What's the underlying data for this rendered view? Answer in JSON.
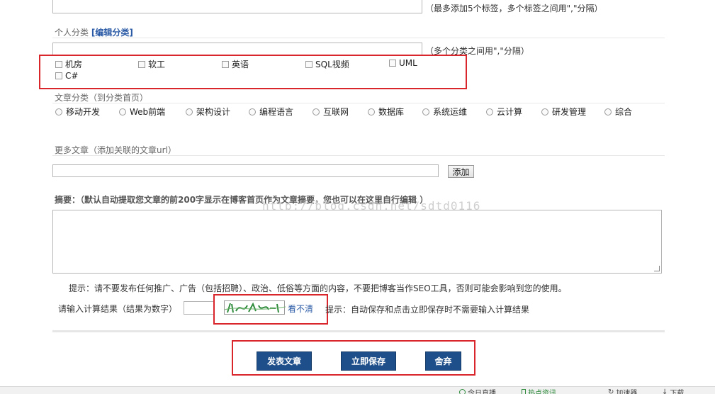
{
  "tags": {
    "hint": "（最多添加5个标签，多个标签之间用\",\"分隔）"
  },
  "personal_category": {
    "title": "个人分类",
    "edit_link": "[编辑分类]",
    "hint": "（多个分类之间用\",\"分隔）",
    "options": [
      "机房",
      "软工",
      "英语",
      "SQL视频",
      "UML",
      "C#"
    ]
  },
  "article_category": {
    "title": "文章分类（到分类首页）",
    "options": [
      "移动开发",
      "Web前端",
      "架构设计",
      "编程语言",
      "互联网",
      "数据库",
      "系统运维",
      "云计算",
      "研发管理",
      "综合"
    ]
  },
  "more_articles": {
    "title": "更多文章（添加关联的文章url）",
    "add_label": "添加"
  },
  "summary": {
    "title": "摘要：（默认自动提取您文章的前200字显示在博客首页作为文章摘要，您也可以在这里自行编辑 ）",
    "watermark": "http://blog.csdn.net/sdtd0116"
  },
  "notice": {
    "text": "提示：请不要发布任何推广、广告（包括招聘）、政治、低俗等方面的内容，不要把博客当作SEO工具，否则可能会影响到您的使用。"
  },
  "captcha": {
    "label": "请输入计算结果（结果为数字）",
    "refresh_link": "看不清",
    "hint": "提示：自动保存和点击立即保存时不需要输入计算结果"
  },
  "actions": {
    "publish": "发表文章",
    "save": "立即保存",
    "discard": "舍弃"
  },
  "statusbar": {
    "items": [
      "今日直播",
      "热点资讯",
      "加速器",
      "下载"
    ]
  }
}
